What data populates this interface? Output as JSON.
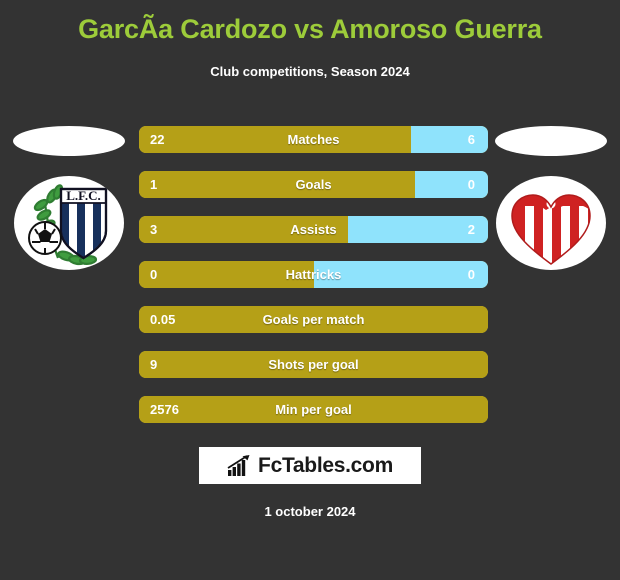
{
  "header": {
    "title": "GarcÃ­a Cardozo vs Amoroso Guerra",
    "subtitle": "Club competitions, Season 2024",
    "title_color": "#9dcc3a"
  },
  "teams": {
    "home": {
      "logo_name": "liverpool-fc-montevideo-crest",
      "crest_text": "L.F.C."
    },
    "away": {
      "logo_name": "river-plate-montevideo-heart-crest"
    }
  },
  "colors": {
    "background": "#333333",
    "home_bar": "#b5a017",
    "away_bar": "#8fe3fc",
    "text": "#ffffff"
  },
  "stats": [
    {
      "label": "Matches",
      "home": "22",
      "away": "6",
      "home_pct": 78,
      "has_away": true
    },
    {
      "label": "Goals",
      "home": "1",
      "away": "0",
      "home_pct": 79,
      "has_away": true
    },
    {
      "label": "Assists",
      "home": "3",
      "away": "2",
      "home_pct": 60,
      "has_away": true
    },
    {
      "label": "Hattricks",
      "home": "0",
      "away": "0",
      "home_pct": 50,
      "has_away": true
    },
    {
      "label": "Goals per match",
      "home": "0.05",
      "away": "",
      "home_pct": 100,
      "has_away": false
    },
    {
      "label": "Shots per goal",
      "home": "9",
      "away": "",
      "home_pct": 100,
      "has_away": false
    },
    {
      "label": "Min per goal",
      "home": "2576",
      "away": "",
      "home_pct": 100,
      "has_away": false
    }
  ],
  "footer": {
    "watermark_text": "FcTables.com",
    "watermark_icon": "bar-chart-arrow-icon",
    "date": "1 october 2024"
  }
}
